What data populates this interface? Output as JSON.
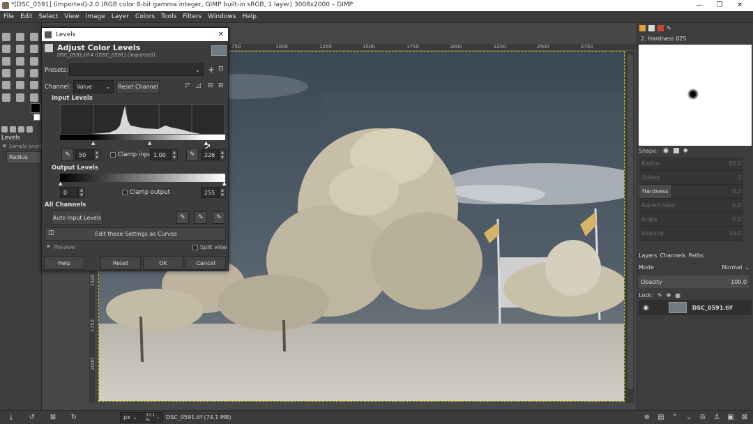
{
  "window": {
    "title": "*[DSC_0591] (imported)-2.0 (RGB color 8-bit gamma integer, GIMP built-in sRGB, 1 layer) 3008x2000 – GIMP",
    "min": "—",
    "max": "❐",
    "close": "✕"
  },
  "menu": [
    "File",
    "Edit",
    "Select",
    "View",
    "Image",
    "Layer",
    "Colors",
    "Tools",
    "Filters",
    "Windows",
    "Help"
  ],
  "left_dock": {
    "tab_title": "Levels",
    "sample_label": "Sample avera",
    "radius_label": "Radius"
  },
  "ruler": [
    "750",
    "1000",
    "1250",
    "1500",
    "1750",
    "2000",
    "2250",
    "2500",
    "2750"
  ],
  "ruler_left": [
    "1500",
    "1750"
  ],
  "levels": {
    "window_title": "Levels",
    "heading": "Adjust Color Levels",
    "subheading": "DSC_0591.tif-4 ([DSC_0591] (imported))",
    "presets_label": "Presets:",
    "presets_value": "",
    "channel_label": "Channel:",
    "channel_value": "Value",
    "reset_channel": "Reset Channel",
    "input_levels": "Input Levels",
    "input_low": "50",
    "clamp_input": "Clamp input",
    "gamma": "1.00",
    "input_high": "226",
    "output_levels": "Output Levels",
    "output_low": "0",
    "clamp_output": "Clamp output",
    "output_high": "255",
    "all_channels": "All Channels",
    "auto_input": "Auto Input Levels",
    "edit_curves": "Edit these Settings as Curves",
    "preview": "Preview",
    "split_view": "Split view",
    "help": "Help",
    "reset": "Reset",
    "ok": "OK",
    "cancel": "Cancel"
  },
  "status": {
    "unit": "px",
    "zoom": "37.1 %",
    "file_info": "DSC_0591.tif (74.1 MB)"
  },
  "right_dock": {
    "brush_name": "2. Hardness 025",
    "shape_label": "Shape:",
    "sliders": [
      "Radius",
      "Spikes",
      "Hardness",
      "Aspect ratio",
      "Angle",
      "Spacing"
    ],
    "sliders_values": [
      "25.0",
      "2",
      "0.2",
      "0.0",
      "0.0",
      "10.0"
    ],
    "tabs": [
      "Layers",
      "Channels",
      "Paths"
    ],
    "mode_label": "Mode",
    "mode_value": "Normal",
    "opacity_label": "Opacity",
    "opacity_value": "100.0",
    "lock_label": "Lock:",
    "layer_name": "DSC_0591.tif"
  },
  "colors": {
    "accent": "#e0a030",
    "sky_top": "#3f4d5c",
    "foliage": "#c9bfa8"
  }
}
